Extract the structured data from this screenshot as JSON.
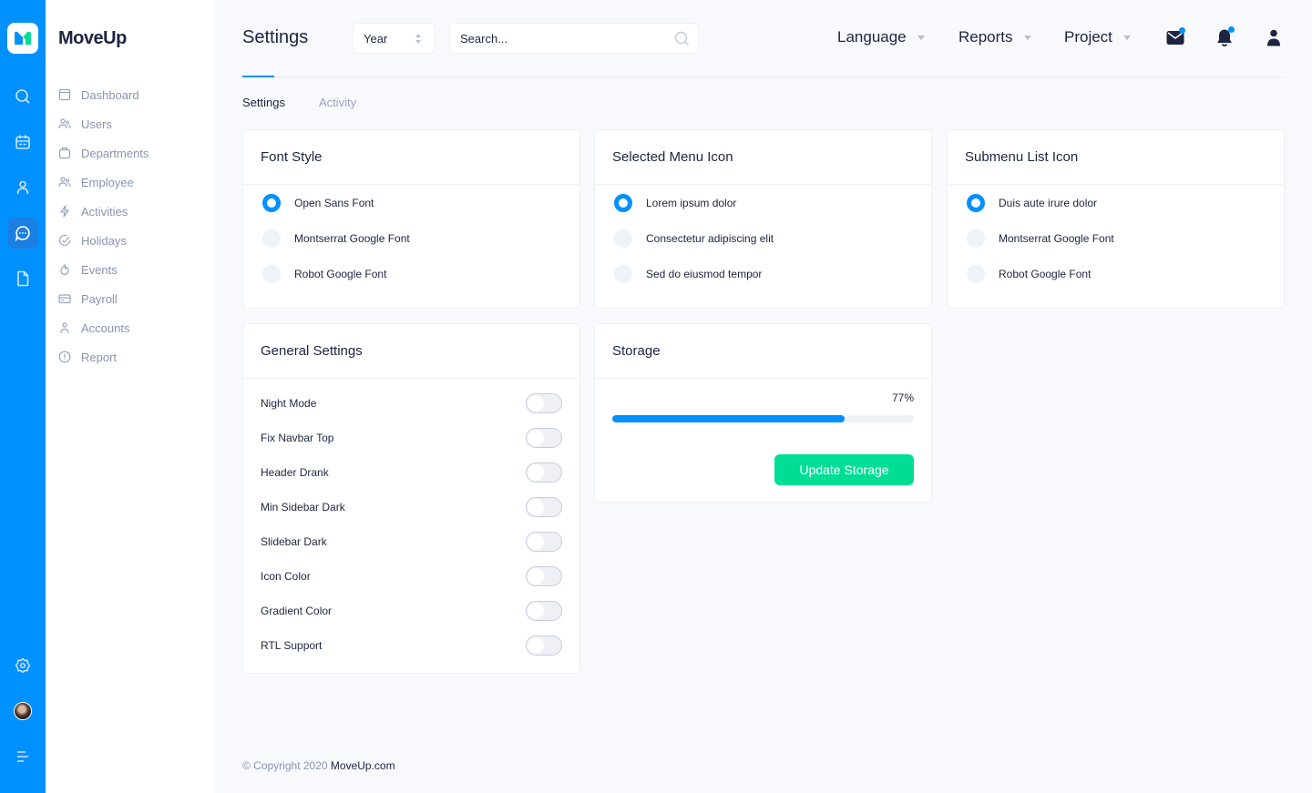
{
  "app": {
    "name": "MoveUp"
  },
  "mini_sidebar": {
    "items": [
      {
        "icon": "search-icon"
      },
      {
        "icon": "calendar-icon"
      },
      {
        "icon": "user-icon"
      },
      {
        "icon": "chat-icon",
        "active": true
      },
      {
        "icon": "file-icon"
      }
    ],
    "bottom": [
      {
        "icon": "gear-icon"
      },
      {
        "icon": "avatar"
      },
      {
        "icon": "menu-icon"
      }
    ]
  },
  "sidebar": {
    "items": [
      {
        "label": "Dashboard",
        "icon": "dashboard-icon"
      },
      {
        "label": "Users",
        "icon": "users-icon"
      },
      {
        "label": "Departments",
        "icon": "departments-icon"
      },
      {
        "label": "Employee",
        "icon": "employee-icon"
      },
      {
        "label": "Activities",
        "icon": "bolt-icon"
      },
      {
        "label": "Holidays",
        "icon": "check-circle-icon"
      },
      {
        "label": "Events",
        "icon": "flame-icon"
      },
      {
        "label": "Payroll",
        "icon": "card-icon"
      },
      {
        "label": "Accounts",
        "icon": "account-icon"
      },
      {
        "label": "Report",
        "icon": "alert-circle-icon"
      }
    ]
  },
  "header": {
    "title": "Settings",
    "year_select": {
      "value": "Year"
    },
    "search": {
      "placeholder": "Search..."
    },
    "nav": [
      {
        "label": "Language"
      },
      {
        "label": "Reports"
      },
      {
        "label": "Project"
      }
    ],
    "icons": [
      "mail-icon",
      "bell-icon",
      "profile-icon"
    ]
  },
  "tabs": [
    {
      "label": "Settings",
      "active": true
    },
    {
      "label": "Activity",
      "active": false
    }
  ],
  "cards": {
    "font_style": {
      "title": "Font Style",
      "options": [
        "Open Sans Font",
        "Montserrat Google Font",
        "Robot Google Font"
      ],
      "selected": 0
    },
    "selected_menu_icon": {
      "title": "Selected Menu Icon",
      "options": [
        "Lorem ipsum dolor",
        "Consectetur adipiscing elit",
        "Sed do eiusmod tempor"
      ],
      "selected": 0
    },
    "submenu_list_icon": {
      "title": "Submenu List Icon",
      "options": [
        "Duis aute irure dolor",
        "Montserrat Google Font",
        "Robot Google Font"
      ],
      "selected": 0
    },
    "general_settings": {
      "title": "General Settings",
      "toggles": [
        {
          "label": "Night Mode",
          "on": false
        },
        {
          "label": "Fix Navbar Top",
          "on": false
        },
        {
          "label": "Header Drank",
          "on": false
        },
        {
          "label": "Min Sidebar Dark",
          "on": false
        },
        {
          "label": "Slidebar Dark",
          "on": false
        },
        {
          "label": "Icon Color",
          "on": false
        },
        {
          "label": "Gradient Color",
          "on": false
        },
        {
          "label": "RTL Support",
          "on": false
        }
      ]
    },
    "storage": {
      "title": "Storage",
      "percent_label": "77%",
      "percent": 77,
      "button": "Update Storage"
    }
  },
  "footer": {
    "copyright": "© Copyright 2020",
    "link": "MoveUp.com"
  },
  "colors": {
    "primary": "#0090ff",
    "success": "#00de95",
    "text": "#1c2440",
    "muted": "#8a93b0"
  }
}
